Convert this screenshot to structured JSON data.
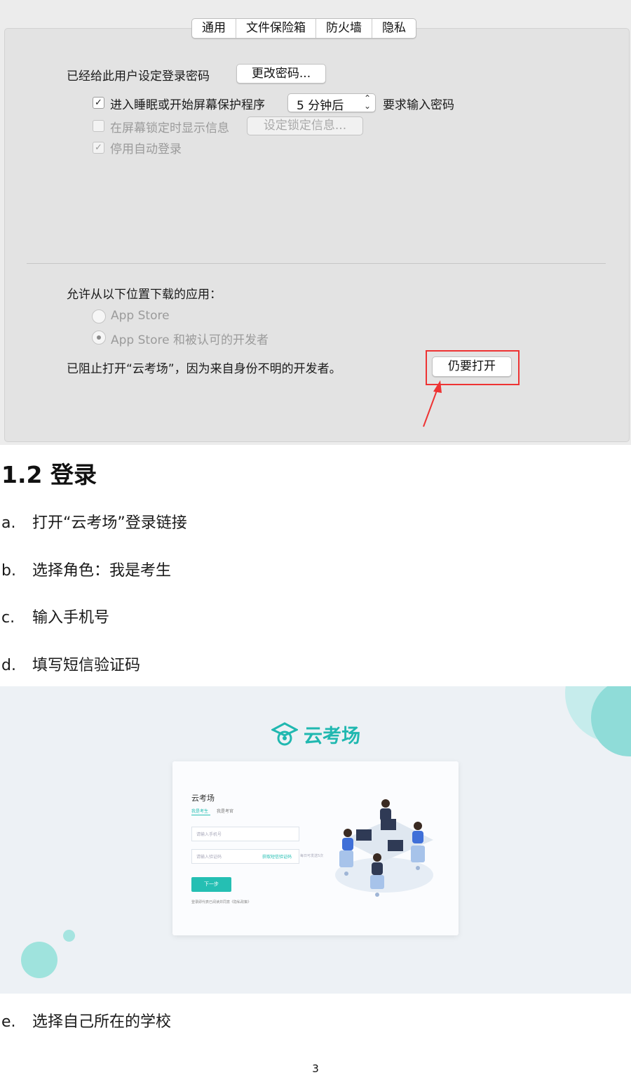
{
  "prefs": {
    "tabs": [
      "通用",
      "文件保险箱",
      "防火墙",
      "隐私"
    ],
    "password_label": "已经给此用户设定登录密码",
    "change_password_button": "更改密码...",
    "sleep_checkbox_label": "进入睡眠或开始屏幕保护程序",
    "sleep_select_value": "5 分钟后",
    "require_password_label": "要求输入密码",
    "show_message_label": "在屏幕锁定时显示信息",
    "set_lock_message_button": "设定锁定信息...",
    "disable_autologin_label": "停用自动登录",
    "allow_apps_label": "允许从以下位置下载的应用：",
    "radio_app_store": "App Store",
    "radio_app_store_devs": "App Store 和被认可的开发者",
    "blocked_message": "已阻止打开“云考场”，因为来自身份不明的开发者。",
    "open_anyway_button": "仍要打开"
  },
  "doc": {
    "heading": "1.2 登录",
    "steps": [
      {
        "label": "a.",
        "text": "打开“云考场”登录链接"
      },
      {
        "label": "b.",
        "text": "选择角色：我是考生"
      },
      {
        "label": "c.",
        "text": "输入手机号"
      },
      {
        "label": "d.",
        "text": "填写短信验证码"
      },
      {
        "label": "e.",
        "text": "选择自己所在的学校"
      }
    ],
    "page_number": "3"
  },
  "login": {
    "logo_text": "云考场",
    "card_title": "云考场",
    "tab_student": "我是考生",
    "tab_teacher": "我是考官",
    "phone_placeholder": "请输入手机号",
    "code_placeholder": "请输入验证码",
    "get_code_label": "获取短信验证码",
    "code_hint": "每日可发送5次",
    "next_button": "下一步",
    "agreement": "登录即代表已阅读并同意《隐私政策》"
  },
  "colors": {
    "accent": "#25bfb3",
    "red_highlight": "#e33333",
    "panel_bg": "#e3e3e3"
  }
}
